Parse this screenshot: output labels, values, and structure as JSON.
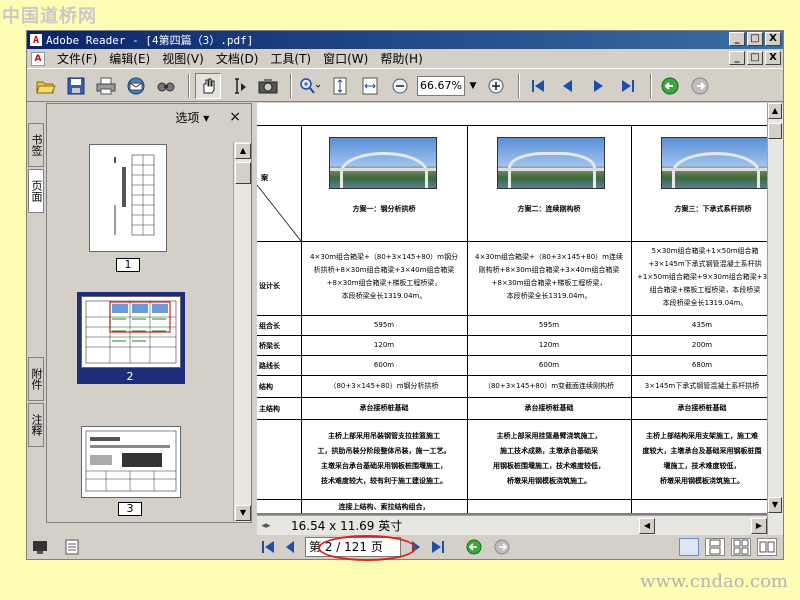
{
  "watermark_top": "中国道桥网",
  "watermark_bottom": "www.cndao.com",
  "window": {
    "title": "Adobe Reader - [4第四篇（3）.pdf]",
    "buttons": {
      "minimize": "_",
      "maximize": "□",
      "close": "X"
    }
  },
  "menu": {
    "items": [
      "文件(F)",
      "编辑(E)",
      "视图(V)",
      "文档(D)",
      "工具(T)",
      "窗口(W)",
      "帮助(H)"
    ]
  },
  "toolbar": {
    "zoom_value": "66.67%",
    "icons": [
      "open-icon",
      "save-icon",
      "print-icon",
      "email-icon",
      "search-icon",
      "hand-icon",
      "select-text-icon",
      "snapshot-icon",
      "zoom-in-icon",
      "actual-size-icon",
      "fit-width-icon",
      "zoom-out-icon",
      "zoom-plus-icon",
      "first-page-icon",
      "prev-page-icon",
      "next-page-icon",
      "last-page-icon",
      "go-back-icon",
      "go-forward-icon"
    ]
  },
  "side_tabs": [
    "书签",
    "页面",
    "附件",
    "注释"
  ],
  "panel": {
    "options_label": "选项 ▾",
    "close_label": "×",
    "thumbnails": [
      {
        "label": "1",
        "selected": false
      },
      {
        "label": "2",
        "selected": true
      },
      {
        "label": "3",
        "selected": false
      }
    ]
  },
  "document": {
    "header_cell": "案",
    "row_labels": [
      "设计长",
      "组合长",
      "桥梁长",
      "路线长",
      "结构",
      "主结构"
    ],
    "schemes": [
      {
        "caption": "方案一：钢分析拱桥",
        "desc": [
          "4×30m组合箱梁+（80+3×145+80）m钢分",
          "析拱桥+8×30m组合箱梁+3×40m组合箱梁",
          "+8×30m组合箱梁+梯板工程桥梁，",
          "本段桥梁全长1319.04m。"
        ],
        "v1": "595m",
        "v2": "120m",
        "v3": "600m",
        "struct": "（80+3×145+80）m钢分析拱桥",
        "main": "承台接桥桩基础",
        "notes": [
          "主桥上部采用吊装钢管支拉挂篮施工",
          "工，拱肋吊装分阶段整体吊装，施一工艺。",
          "主墩采台承台基础采用钢板桩围堰施工，",
          "技术难度较大，较有利于施工建设施工。"
        ],
        "bottom": "连接上结构、索拉结构组合，"
      },
      {
        "caption": "方案二：连续刚构桥",
        "desc": [
          "4×30m组合箱梁+（80+3×145+80）m连续",
          "刚构桥+8×30m组合箱梁+3×40m组合箱梁",
          "+8×30m组合箱梁+梯板工程桥梁，",
          "本段桥梁全长1319.04m。"
        ],
        "v1": "595m",
        "v2": "120m",
        "v3": "600m",
        "struct": "（80+3×145+80）m变截面连续刚构桥",
        "main": "承台接桥桩基础",
        "notes": [
          "主桥上部采用挂篮悬臂浇筑施工，",
          "施工技术成熟，主墩承台基础采",
          "用钢板桩围堰施工，技术难度较低，",
          "桥墩采用钢模板浇筑施工。"
        ],
        "bottom": ""
      },
      {
        "caption": "方案三：下承式系杆拱桥",
        "desc": [
          "5×30m组合箱梁+1×50m组合箱",
          "+3×145m下承式钢管混凝土系杆拱",
          "+1×50m组合箱梁+9×30m组合箱梁+3×",
          "组合箱梁+梯板工程桥梁，本段桥梁",
          "本段桥梁全长1319.04m。"
        ],
        "v1": "435m",
        "v2": "200m",
        "v3": "680m",
        "struct": "3×145m下承式钢管混凝土系杆拱桥",
        "main": "承台接桥桩基础",
        "notes": [
          "主桥上部结构采用支架施工，施工难",
          "度较大，主墩承台及基础采用钢板桩围",
          "堰施工，技术难度较低，",
          "桥墩采用钢模板浇筑施工。"
        ],
        "bottom": ""
      }
    ],
    "page_size": "16.54 x 11.69 英寸"
  },
  "status": {
    "page_indicator": "第 2 / 121 页"
  }
}
